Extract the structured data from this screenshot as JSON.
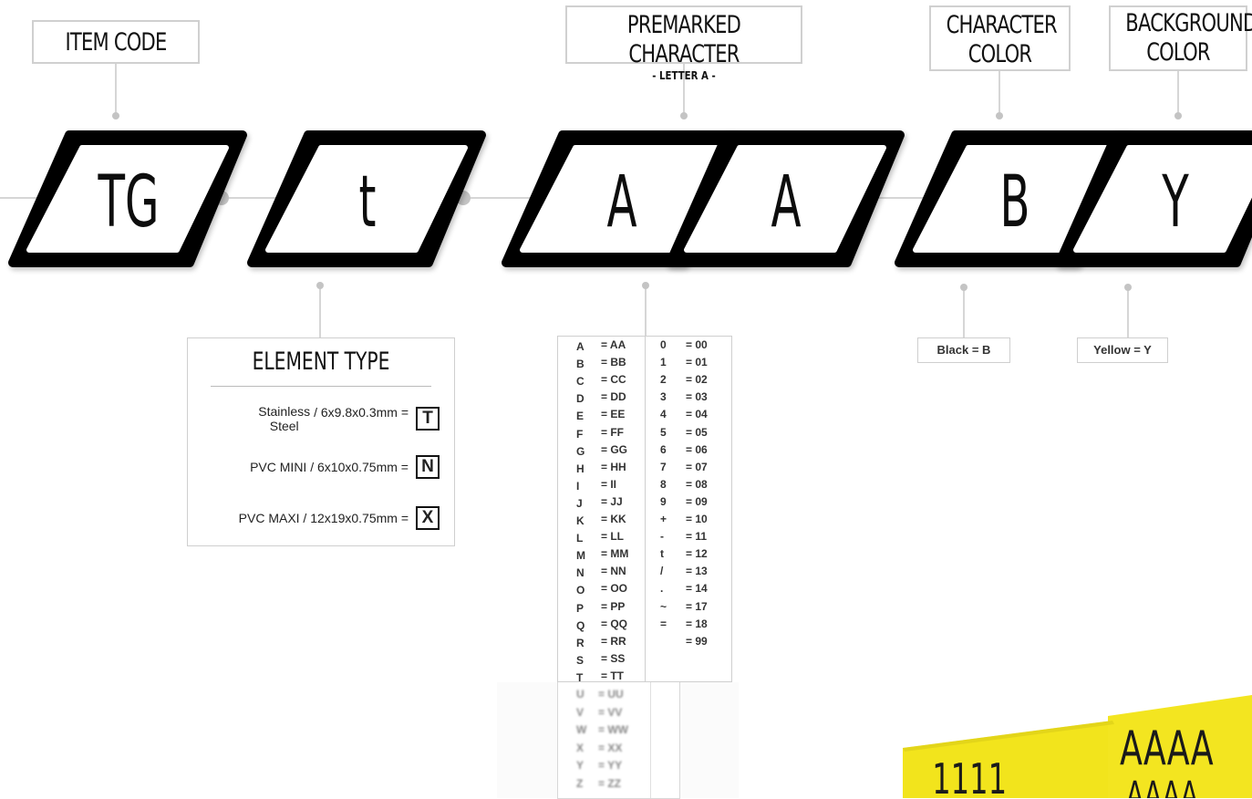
{
  "callouts": {
    "item_code": "ITEM CODE",
    "premarked_title": "PREMARKED CHARACTER",
    "premarked_sub": "- LETTER A -",
    "character_color_1": "CHARACTER",
    "character_color_2": "COLOR",
    "background_color_1": "BACKGROUND",
    "background_color_2": "COLOR"
  },
  "code_segments": [
    "TG",
    "t",
    "A",
    "A",
    "B",
    "Y"
  ],
  "element_type": {
    "title": "ELEMENT TYPE",
    "rows": [
      {
        "label_line1": "Stainless",
        "label_line2": "Steel",
        "dims": "/ 6x9.8x0.3mm =",
        "code": "T"
      },
      {
        "label": "PVC MINI / 6x10x0.75mm =",
        "code": "N"
      },
      {
        "label": "PVC MAXI / 12x19x0.75mm =",
        "code": "X"
      }
    ]
  },
  "char_table": {
    "letters": [
      [
        "A",
        "= AA"
      ],
      [
        "B",
        "= BB"
      ],
      [
        "C",
        "= CC"
      ],
      [
        "D",
        "= DD"
      ],
      [
        "E",
        "= EE"
      ],
      [
        "F",
        "= FF"
      ],
      [
        "G",
        "= GG"
      ],
      [
        "H",
        "= HH"
      ],
      [
        "I",
        "= II"
      ],
      [
        "J",
        "= JJ"
      ],
      [
        "K",
        "= KK"
      ],
      [
        "L",
        "= LL"
      ],
      [
        "M",
        "= MM"
      ],
      [
        "N",
        "= NN"
      ],
      [
        "O",
        "= OO"
      ],
      [
        "P",
        "= PP"
      ],
      [
        "Q",
        "= QQ"
      ],
      [
        "R",
        "= RR"
      ],
      [
        "S",
        "= SS"
      ],
      [
        "T",
        "= TT"
      ]
    ],
    "letters_faded": [
      [
        "U",
        "= UU"
      ],
      [
        "V",
        "= VV"
      ],
      [
        "W",
        "= WW"
      ],
      [
        "X",
        "= XX"
      ],
      [
        "Y",
        "= YY"
      ],
      [
        "Z",
        "= ZZ"
      ]
    ],
    "symbols": [
      [
        "0",
        "= 00"
      ],
      [
        "1",
        "= 01"
      ],
      [
        "2",
        "= 02"
      ],
      [
        "3",
        "= 03"
      ],
      [
        "4",
        "= 04"
      ],
      [
        "5",
        "= 05"
      ],
      [
        "6",
        "= 06"
      ],
      [
        "7",
        "= 07"
      ],
      [
        "8",
        "= 08"
      ],
      [
        "9",
        "= 09"
      ],
      [
        "+",
        "= 10"
      ],
      [
        "-",
        "= 11"
      ],
      [
        "t",
        "= 12"
      ],
      [
        "/",
        "= 13"
      ],
      [
        ".",
        "= 14"
      ],
      [
        "~",
        "= 17"
      ],
      [
        "=",
        "= 18"
      ],
      [
        "",
        "= 99"
      ]
    ]
  },
  "colors": {
    "character": "Black = B",
    "background": "Yellow = Y"
  },
  "photo_text": {
    "numbers": "1111",
    "letters": "AAAA"
  },
  "palette": {
    "frame": "#000000",
    "line": "#c8c8c8",
    "dot": "#c4c4c4",
    "yellow": "#f2e41c"
  }
}
